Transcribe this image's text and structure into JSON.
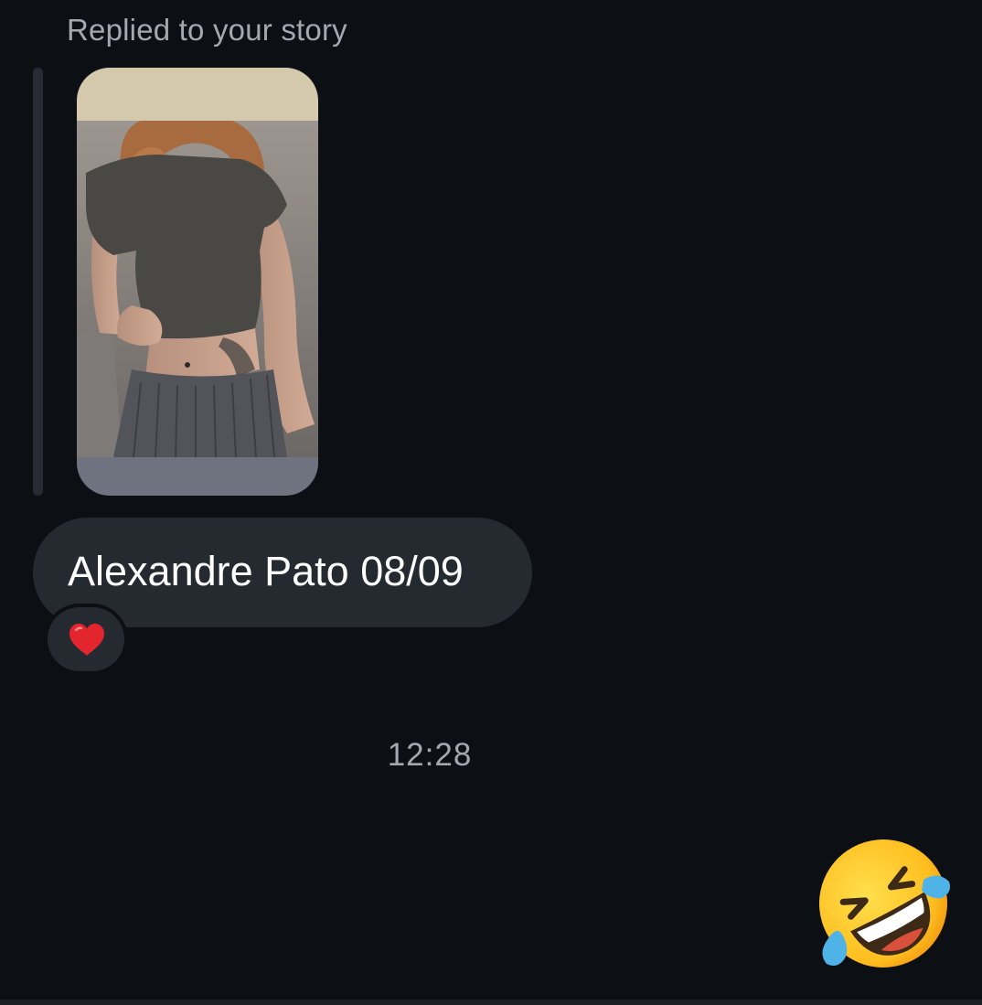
{
  "story_reply": {
    "label": "Replied to your story",
    "thumbnail_icon": "story-photo-thumbnail"
  },
  "message": {
    "text": "Alexandre Pato 08/09",
    "reaction_icon": "red-heart-icon"
  },
  "divider": {
    "time": "12:28"
  },
  "sent_message": {
    "emoji_icon": "rolling-on-the-floor-laughing-icon"
  },
  "colors": {
    "background": "#0c0f14",
    "bubble": "#252a31",
    "secondary_text": "#a4a8b0",
    "heart": "#e3262e",
    "emoji_face": "#ffc72c"
  }
}
